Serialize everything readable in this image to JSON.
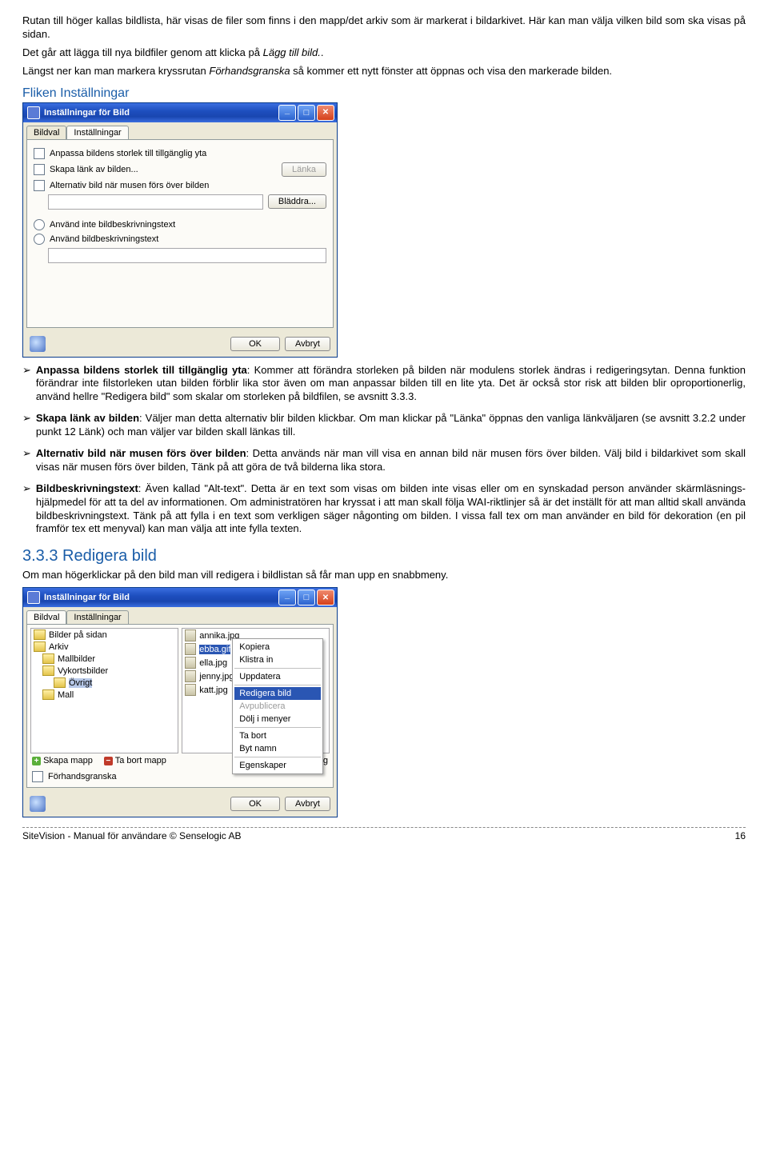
{
  "text": {
    "p1": "Rutan till höger kallas bildlista, här visas de filer som finns i den mapp/det arkiv som är markerat i bildarkivet. Här kan man välja vilken bild som ska visas på sidan.",
    "p2a": "Det går att lägga till nya bildfiler genom att klicka på ",
    "p2b": "Lägg till bild.",
    "p2c": ".",
    "p3a": "Längst ner kan man markera kryssrutan ",
    "p3b": "Förhandsgranska",
    "p3c": " så kommer ett nytt fönster att öppnas och visa den markerade bilden.",
    "h_fliken": "Fliken Inställningar",
    "b1_bold": "Anpassa bildens storlek till tillgänglig yta",
    "b1_rest": ": Kommer att förändra storleken på bilden när modulens storlek ändras i redigeringsytan. Denna funktion förändrar inte filstorleken utan bilden förblir lika stor även om man anpassar bilden till en lite yta. Det är också stor risk att bilden blir oproportionerlig, använd hellre \"Redigera bild\" som skalar om storleken på bildfilen, se avsnitt 3.3.3.",
    "b2_bold": "Skapa länk av bilden",
    "b2_rest": ": Väljer man detta alternativ blir bilden klickbar. Om man klickar på \"Länka\" öppnas den vanliga länkväljaren (se avsnitt 3.2.2 under punkt 12 Länk) och man väljer var bilden skall länkas till.",
    "b3_bold": "Alternativ bild när musen förs över bilden",
    "b3_rest": ": Detta används när man vill visa en annan bild när musen förs över bilden. Välj bild i bildarkivet som skall visas när musen förs över bilden, Tänk på att göra de två bilderna lika stora.",
    "b4_bold": "Bildbeskrivningstext",
    "b4_rest": ": Även kallad \"Alt-text\". Detta är en text som visas om bilden inte visas eller om en synskadad person använder skärmläsnings-hjälpmedel för att ta del av informationen. Om administratören har kryssat i att man skall följa WAI-riktlinjer så är det inställt för att man alltid skall använda bildbeskrivningstext. Tänk på att fylla i en text som verkligen säger någonting om bilden. I vissa fall tex om man använder en bild för dekoration (en pil framför tex ett menyval) kan man välja att inte fylla texten.",
    "h_333": "3.3.3 Redigera bild",
    "p_333": "Om man högerklickar på den bild man vill redigera i bildlistan så får man upp en snabbmeny.",
    "footer_l": "SiteVision - Manual för användare © Senselogic AB",
    "footer_r": "16"
  },
  "dlg1": {
    "title": "Inställningar för Bild",
    "tabs": {
      "bildval": "Bildval",
      "inst": "Inställningar"
    },
    "opt_anpassa": "Anpassa bildens storlek till tillgänglig yta",
    "opt_lank": "Skapa länk av bilden...",
    "btn_lanka": "Länka",
    "opt_alt": "Alternativ bild när musen förs över bilden",
    "btn_bladdra": "Bläddra...",
    "opt_radio1": "Använd inte bildbeskrivningstext",
    "opt_radio2": "Använd bildbeskrivningstext",
    "btn_ok": "OK",
    "btn_cancel": "Avbryt"
  },
  "dlg2": {
    "title": "Inställningar för Bild",
    "tabs": {
      "bildval": "Bildval",
      "inst": "Inställningar"
    },
    "tree": {
      "t1": "Bilder på sidan",
      "t2": "Arkiv",
      "t3": "Mallbilder",
      "t4": "Vykortsbilder",
      "t5": "Övrigt",
      "t6": "Mall"
    },
    "files": {
      "f1": "annika.jpg",
      "f2": "ebba.gif",
      "f3": "ella.jpg",
      "f4": "jenny.jpg",
      "f5": "katt.jpg"
    },
    "ctx": {
      "c1": "Kopiera",
      "c2": "Klistra in",
      "c3": "Uppdatera",
      "c4": "Redigera bild",
      "c5": "Avpublicera",
      "c6": "Dölj i menyer",
      "c7": "Ta bort",
      "c8": "Byt namn",
      "c9": "Egenskaper"
    },
    "toolbar": {
      "skapa": "Skapa mapp",
      "tabort": "Ta bort mapp",
      "lagg": "Lägg"
    },
    "forhand": "Förhandsgranska",
    "btn_ok": "OK",
    "btn_cancel": "Avbryt"
  }
}
